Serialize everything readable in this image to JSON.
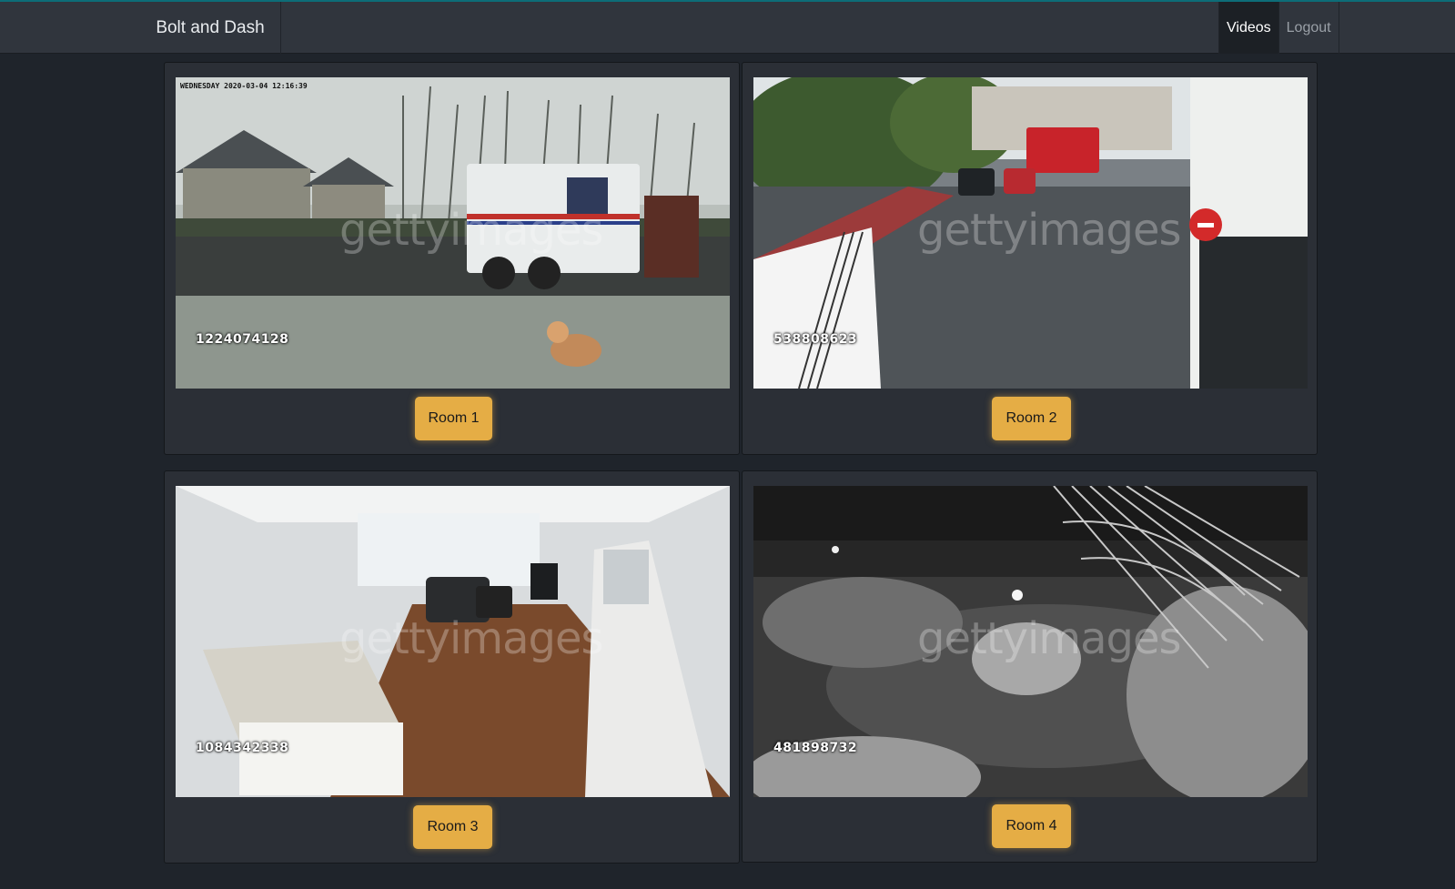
{
  "app": {
    "brand": "Bolt and Dash"
  },
  "nav": {
    "videos": "Videos",
    "logout": "Logout"
  },
  "colors": {
    "accent": "#e5ad45",
    "navbar": "#30353d",
    "background": "#1f242b",
    "card": "#2b2f36"
  },
  "cameras": [
    {
      "id_text": "1224074128",
      "timestamp": "WEDNESDAY 2020-03-04 12:16:39",
      "watermark": "gettyimages",
      "button": "Room 1",
      "scene": "street-mail-truck-dog"
    },
    {
      "id_text": "538808623",
      "watermark": "gettyimages",
      "button": "Room 2",
      "scene": "city-street-bus"
    },
    {
      "id_text": "1084342338",
      "watermark": "gettyimages",
      "button": "Room 3",
      "scene": "living-room-kitchen"
    },
    {
      "id_text": "481898732",
      "watermark": "gettyimages",
      "button": "Room 4",
      "scene": "night-vision-yard"
    }
  ]
}
